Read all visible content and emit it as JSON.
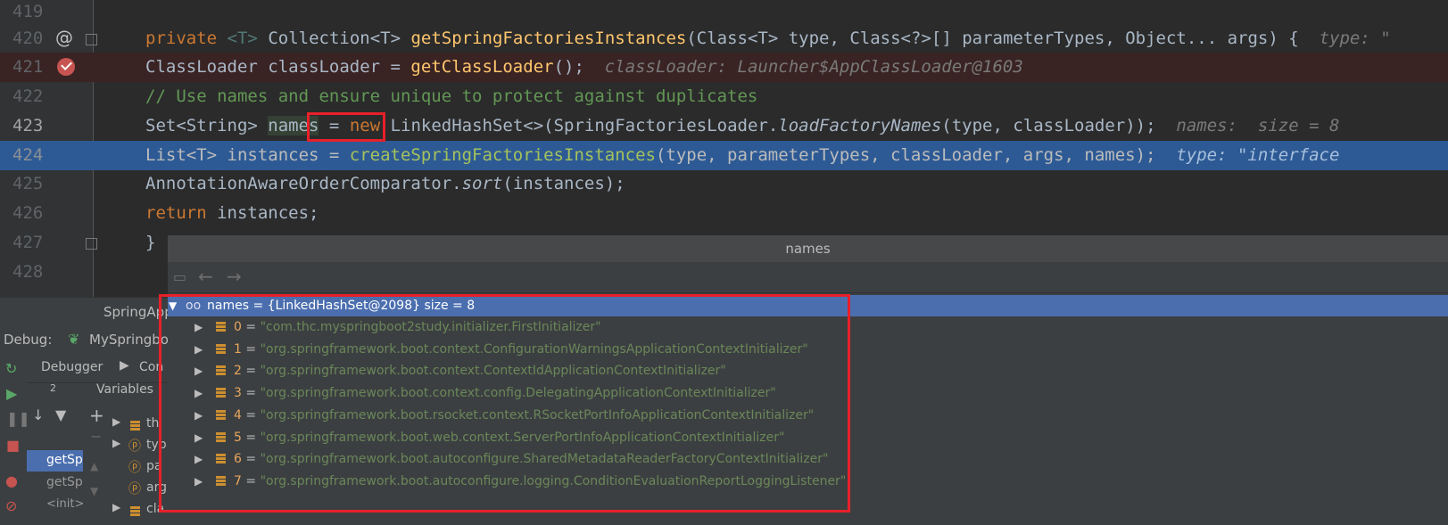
{
  "editor": {
    "lines": [
      {
        "num": "419"
      },
      {
        "num": "420",
        "gutter_icon": "@"
      },
      {
        "num": "421"
      },
      {
        "num": "422"
      },
      {
        "num": "423"
      },
      {
        "num": "424"
      },
      {
        "num": "425"
      },
      {
        "num": "426"
      },
      {
        "num": "427"
      },
      {
        "num": "428"
      }
    ],
    "code": {
      "l420": {
        "kw": "private",
        "t1": "<T>",
        "ret": "Collection<T>",
        "fn": "getSpringFactoriesInstances",
        "params": "(Class<T> type, Class<?>[] parameterTypes, Object... args) {",
        "hint": "type: \""
      },
      "l421": {
        "text1": "ClassLoader classLoader = ",
        "fn": "getClassLoader",
        "text2": "();",
        "hint": "classLoader: Launcher$AppClassLoader@1603"
      },
      "l422": {
        "comment": "// Use names and ensure unique to protect against duplicates"
      },
      "l423": {
        "text1": "Set<String> ",
        "var": "names",
        "text2": " = ",
        "kw": "new",
        "text3": " LinkedHashSet<>(SpringFactoriesLoader.",
        "italic": "loadFactoryNames",
        "text4": "(type, classLoader));",
        "hint": "names:  size = 8"
      },
      "l424": {
        "text1": "List<T> instances = ",
        "fn": "createSpringFactoriesInstances",
        "text2": "(type, parameterTypes, classLoader, args, names);",
        "hint": "type: \"interface"
      },
      "l425": {
        "text1": "AnnotationAwareOrderComparator.",
        "italic": "sort",
        "text2": "(instances);"
      },
      "l426": {
        "kw": "return",
        "text": " instances;"
      },
      "l427": {
        "text": "}"
      }
    }
  },
  "popup": {
    "title": "names",
    "root": "names = {LinkedHashSet@2098}  size = 8",
    "items": [
      {
        "index": "0",
        "value": "\"com.thc.myspringboot2study.initializer.FirstInitializer\""
      },
      {
        "index": "1",
        "value": "\"org.springframework.boot.context.ConfigurationWarningsApplicationContextInitializer\""
      },
      {
        "index": "2",
        "value": "\"org.springframework.boot.context.ContextIdApplicationContextInitializer\""
      },
      {
        "index": "3",
        "value": "\"org.springframework.boot.context.config.DelegatingApplicationContextInitializer\""
      },
      {
        "index": "4",
        "value": "\"org.springframework.boot.rsocket.context.RSocketPortInfoApplicationContextInitializer\""
      },
      {
        "index": "5",
        "value": "\"org.springframework.boot.web.context.ServerPortInfoApplicationContextInitializer\""
      },
      {
        "index": "6",
        "value": "\"org.springframework.boot.autoconfigure.SharedMetadataReaderFactoryContextInitializer\""
      },
      {
        "index": "7",
        "value": "\"org.springframework.boot.autoconfigure.logging.ConditionEvaluationReportLoggingListener\""
      }
    ]
  },
  "debug": {
    "breadcrumb": "SpringApp",
    "label": "Debug:",
    "session_tab": "MySpringboo",
    "tab_debugger": "Debugger",
    "tab_console": "Con",
    "threads_count": "2",
    "variables_label": "Variables",
    "frames": [
      "getSp",
      "getSp",
      "<init>"
    ],
    "vars": [
      "thi",
      "typ",
      "pa",
      "arg",
      "cla"
    ]
  },
  "colors": {
    "breakpoint": "#c75450",
    "execution_line": "#2d5a95",
    "highlight_frame": "#e8202a",
    "selection": "#4b6eaf"
  }
}
